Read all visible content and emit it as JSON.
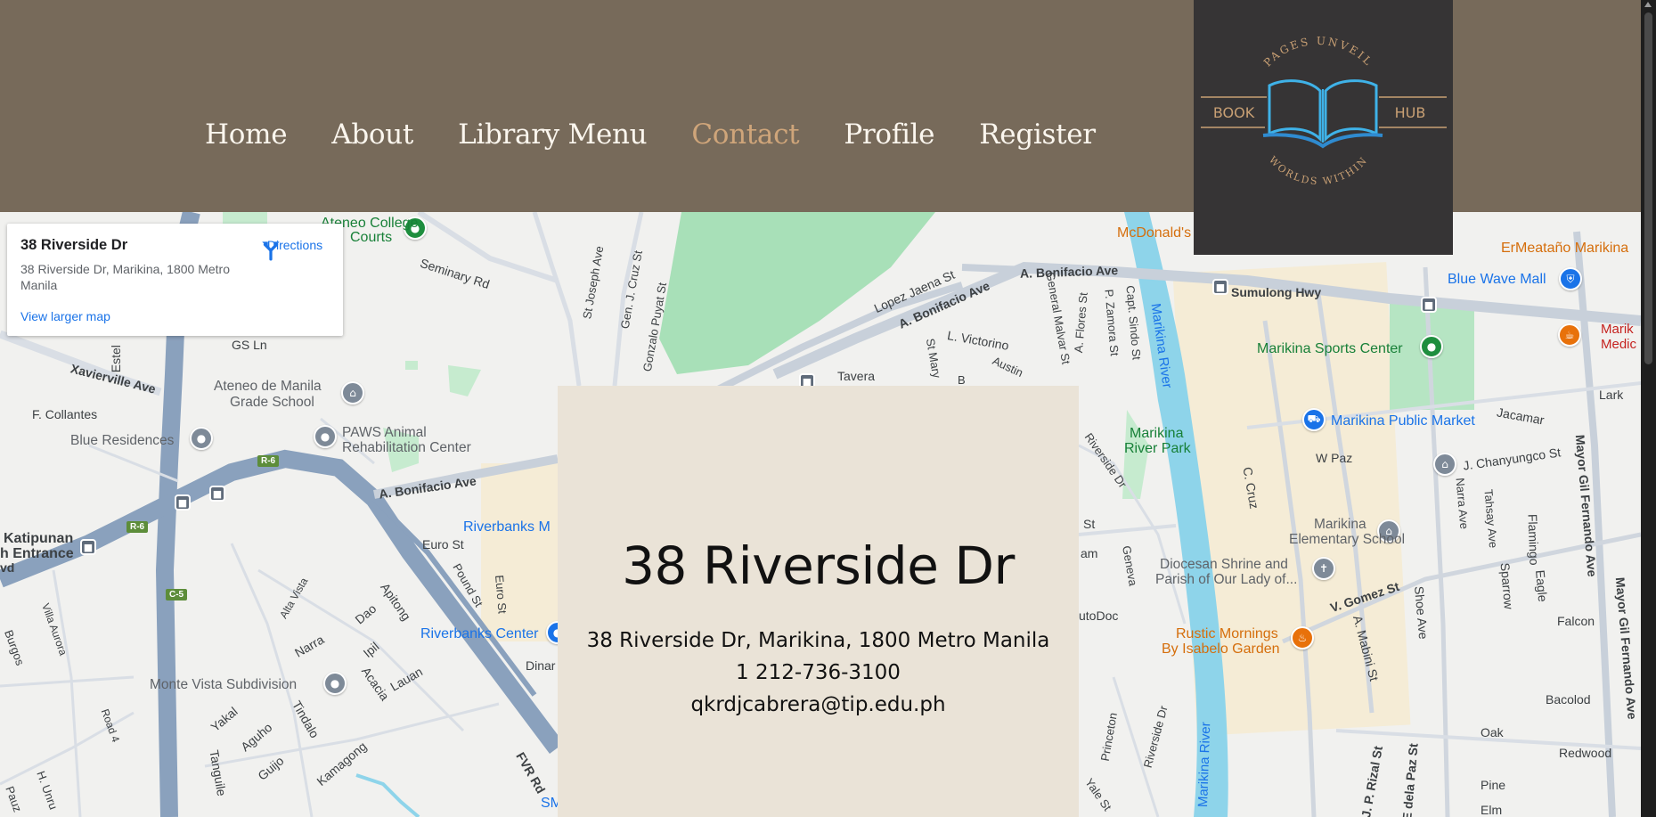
{
  "nav": {
    "items": [
      {
        "label": "Home",
        "active": false
      },
      {
        "label": "About",
        "active": false
      },
      {
        "label": "Library Menu",
        "active": false
      },
      {
        "label": "Contact",
        "active": true
      },
      {
        "label": "Profile",
        "active": false
      },
      {
        "label": "Register",
        "active": false
      }
    ]
  },
  "logo": {
    "top_text": "PAGES UNVEIL",
    "left_text": "BOOK",
    "right_text": "HUB",
    "bottom_text": "WORLDS WITHIN",
    "icon": "open-book-icon"
  },
  "place_card": {
    "title": "38 Riverside Dr",
    "address": "38 Riverside Dr, Marikina, 1800 Metro Manila",
    "directions_label": "Directions",
    "larger_map_label": "View larger map"
  },
  "contact": {
    "title": "38 Riverside Dr",
    "address": "38 Riverside Dr, Marikina, 1800 Metro Manila",
    "phone": "1 212-736-3100",
    "email": "qkrdjcabrera@tip.edu.ph"
  },
  "map_labels": {
    "ateneo_college": "Ateneo College",
    "ateneo_courts": "Courts",
    "seminary_rd": "Seminary Rd",
    "gs_ln": "GS Ln",
    "estel": "Estel",
    "xavierville": "Xavierville Ave",
    "f_collantes": "F. Collantes",
    "ateneo_grade": "Ateneo de Manila",
    "ateneo_grade2": "Grade School",
    "blue_residences": "Blue Residences",
    "paws1": "PAWS Animal",
    "paws2": "Rehabilitation Center",
    "r6": "R-6",
    "c5": "C-5",
    "a_bonifacio": "A. Bonifacio Ave",
    "a_bonifacio_2": "A. Bonifacio Ave",
    "a_bonifacio_3": "A. Bonifacio Ave",
    "katipunan": "Katipunan",
    "h_entrance": "h Entrance",
    "euro_st": "Euro St",
    "riverbanks_m": "Riverbanks M",
    "riverbanks_center": "Riverbanks Center",
    "monte_vista": "Monte Vista Subdivision",
    "narra": "Narra",
    "dao": "Dao",
    "apitong": "Apitong",
    "ipil": "Ipil",
    "acacia": "Acacia",
    "lauan": "Lauan",
    "alta_vista": "Alta Vista",
    "yakal": "Yakal",
    "aguho": "Aguho",
    "tindalo": "Tindalo",
    "guijo": "Guijo",
    "kamagong": "Kamagong",
    "tanguile": "Tanguile",
    "villa_aurora": "Villa Aurora",
    "road4": "Road 4",
    "fvr_rd": "FVR Rd",
    "st_joseph": "St Joseph Ave",
    "gen_cruz": "Gen. J. Cruz St",
    "gonzalo": "Gonzalo Puyat St",
    "lopez_jaena": "Lopez Jaena St",
    "l_victorino": "L. Victorino",
    "tavera": "Tavera",
    "general_malvar": "General Malvar St",
    "a_flores": "A. Flores St",
    "p_zamora": "P. Zamora St",
    "capt_sindo": "Capt. Sindo St",
    "mcdonalds": "McDonald's",
    "sumulong": "Sumulong Hwy",
    "marikina_river": "Marikina River",
    "marikina_river2": "Marikina River",
    "marikina_river_park1": "Marikina",
    "marikina_river_park2": "River Park",
    "sports_center": "Marikina Sports Center",
    "public_market": "Marikina Public Market",
    "blue_wave": "Blue Wave Mall",
    "ermeatano": "ErMeataño Marikina",
    "marik_medi1": "Marik",
    "marik_medi2": "Medic",
    "lark": "Lark",
    "jacamar": "Jacamar",
    "w_paz": "W Paz",
    "j_chanyungco": "J. Chanyungco St",
    "c_cruz": "C. Cruz",
    "elem1": "Marikina",
    "elem2": "Elementary School",
    "diocesan1": "Diocesan Shrine and",
    "diocesan2": "Parish of Our Lady of...",
    "v_gomez": "V. Gomez St",
    "rustic1": "Rustic Mornings",
    "rustic2": "By Isabelo Garden",
    "a_mabini": "A. Mabini St",
    "shoe_ave": "Shoe Ave",
    "sparrow": "Sparrow",
    "eagle": "Eagle",
    "falcon": "Falcon",
    "bacolod": "Bacolod",
    "oak": "Oak",
    "redwood": "Redwood",
    "pine": "Pine",
    "elm": "Elm",
    "mayor_gil": "Mayor Gil Fernando Ave",
    "mayor_gil2": "Mayor Gil Fernando Ave",
    "flamingo": "Flamingo",
    "narra_ave": "Narra Ave",
    "tahsay": "Tahsay Ave",
    "riverside_dr": "Riverside Dr",
    "riverside_dr2": "Riverside Dr",
    "geneva": "Geneva",
    "autodoc": "utoDoc",
    "princeton": "Princeton",
    "yale": "Yale St",
    "j_p_rizal": "J. P. Rizal St",
    "e_dela_paz": "E dela Paz St",
    "am": "am",
    "st": "St",
    "dinar": "Dinar",
    "sm": "SM",
    "pound_st": "Pound St",
    "euro_st2": "Euro St",
    "burgos": "Burgos",
    "h_unru": "H. Unru",
    "pauz": "Pauz",
    "vd": "vd",
    "austin": "Austin",
    "mary": "St Mary",
    "b": "B"
  }
}
